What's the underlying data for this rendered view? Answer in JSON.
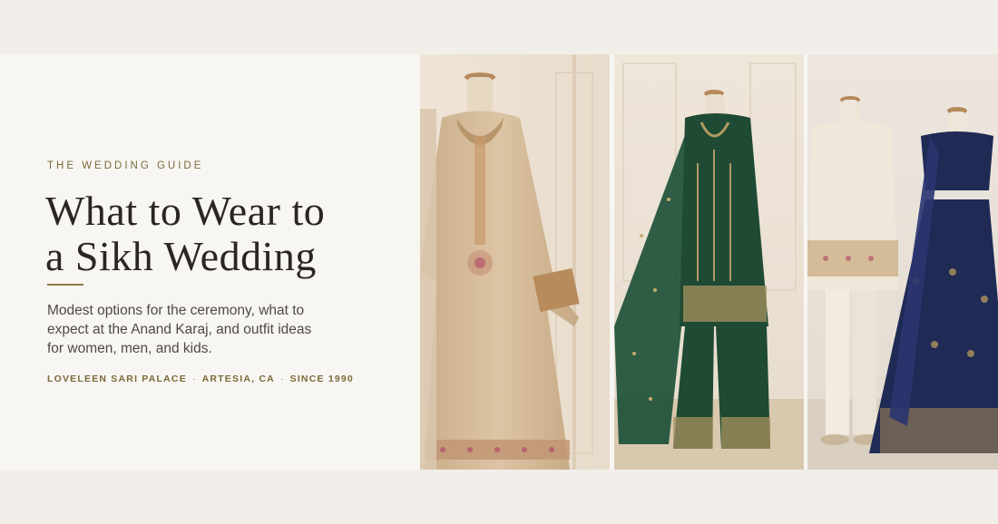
{
  "eyebrow": "THE WEDDING GUIDE",
  "title_line1": "What to Wear to",
  "title_line2": "a Sikh Wedding",
  "description": "Modest options for the ceremony, what to expect at the Anand Karaj, and outfit ideas for women, men, and kids.",
  "meta": {
    "store": "LOVELEEN SARI PALACE",
    "location": "ARTESIA, CA",
    "since": "SINCE 1990",
    "separator": "·"
  },
  "colors": {
    "background": "#f2efea",
    "panel": "#f8f6f2",
    "accent_gold": "#8a7a44",
    "title": "#2a2622",
    "emerald": "#1f4a33",
    "navy": "#1f2a55",
    "champagne": "#d6bd9c",
    "ivory": "#efe7d9"
  },
  "photos": [
    {
      "subject": "champagne anarkali suit on mannequin"
    },
    {
      "subject": "emerald green kurta with palazzo and dupatta"
    },
    {
      "subject": "ivory sherwani and navy lehenga"
    }
  ]
}
